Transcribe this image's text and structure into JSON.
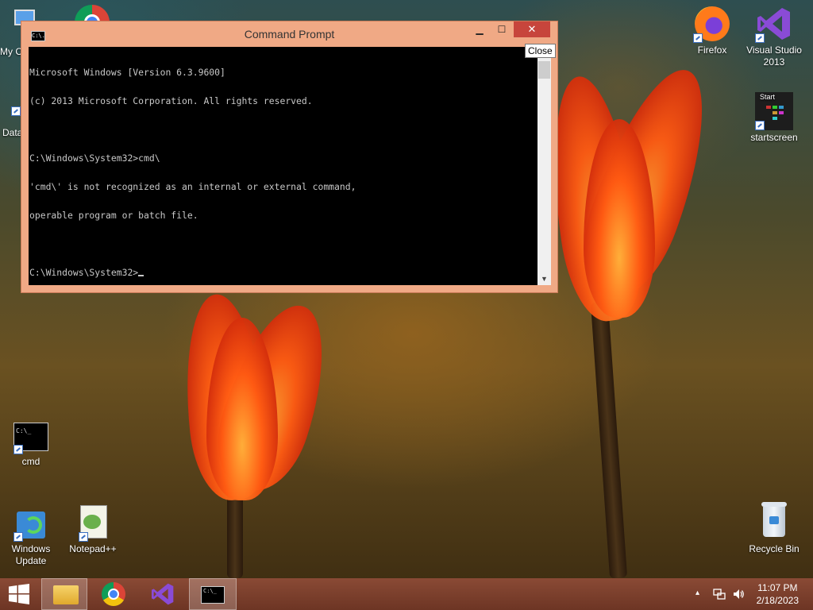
{
  "desktop": {
    "icons": {
      "my_computer": "My C",
      "data": "Data",
      "firefox": "Firefox",
      "visual_studio": "Visual Studio 2013",
      "startscreen": "startscreen",
      "startscreen_tile": "Start",
      "cmd": "cmd",
      "windows_update": "Windows Update",
      "notepadpp": "Notepad++",
      "recycle_bin": "Recycle Bin"
    }
  },
  "window": {
    "title": "Command Prompt",
    "icon_text": "C:\\.",
    "minimize": "▁",
    "maximize": "☐",
    "close": "✕",
    "close_tooltip": "Close",
    "console_lines": [
      "Microsoft Windows [Version 6.3.9600]",
      "(c) 2013 Microsoft Corporation. All rights reserved.",
      "",
      "C:\\Windows\\System32>cmd\\",
      "'cmd\\' is not recognized as an internal or external command,",
      "operable program or batch file.",
      "",
      "C:\\Windows\\System32>"
    ]
  },
  "taskbar": {
    "clock_time": "11:07 PM",
    "clock_date": "2/18/2023",
    "tray_chevron": "▴"
  },
  "colors": {
    "taskbar": "#6d3524",
    "window_frame": "#f0a985",
    "close_button": "#c7453c"
  }
}
